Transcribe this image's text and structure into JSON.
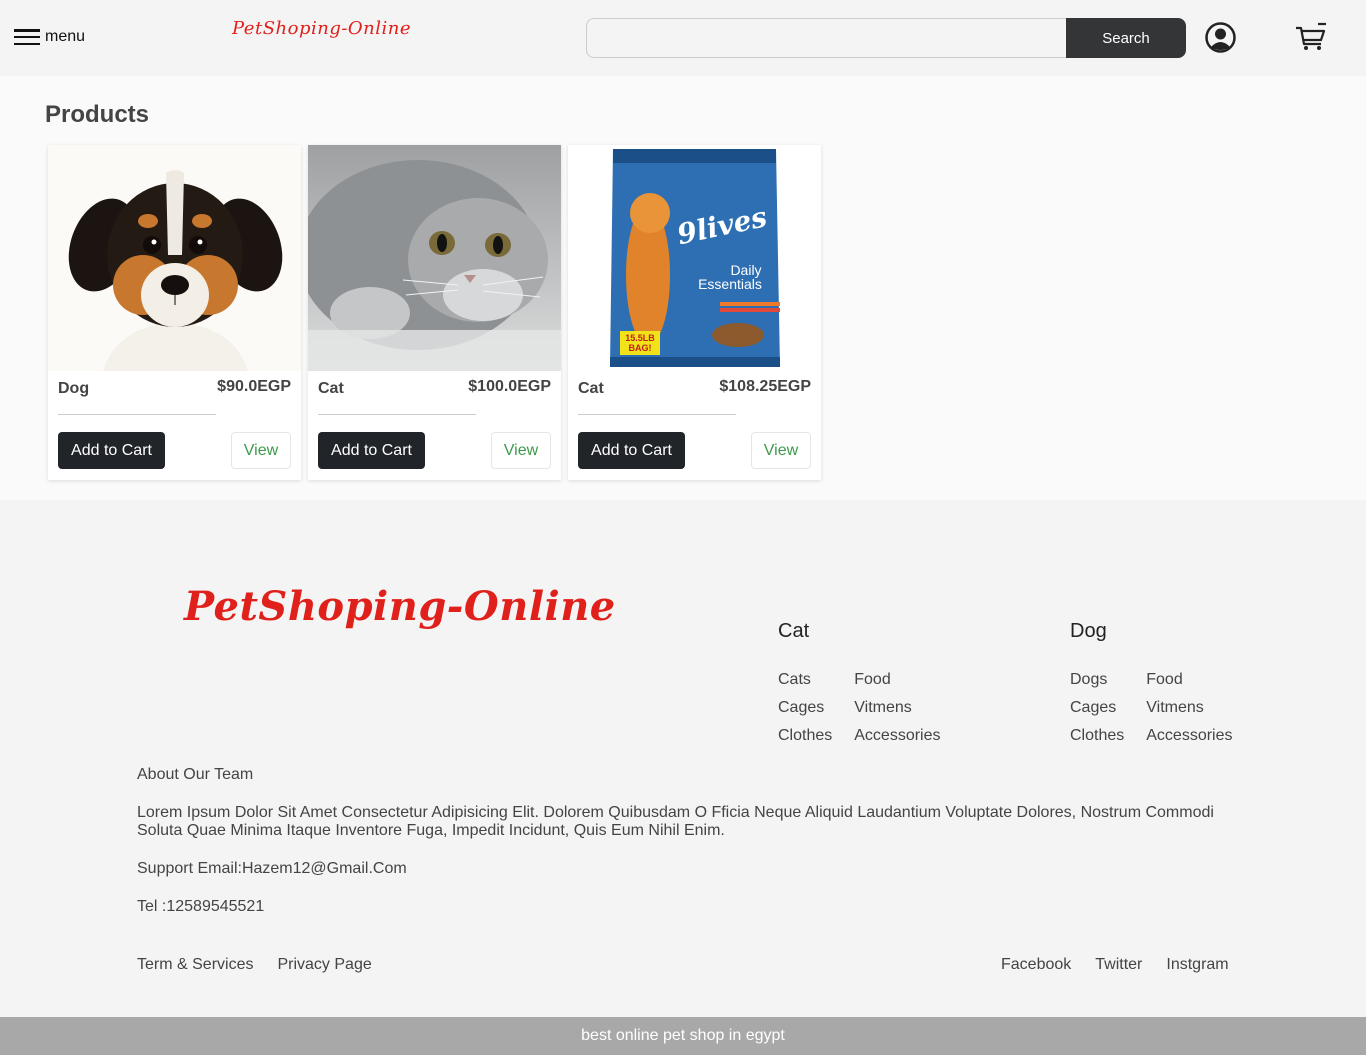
{
  "header": {
    "menu_label": "menu",
    "logo_text": "PetShoping-Online",
    "search_placeholder": "",
    "search_button": "Search"
  },
  "products": {
    "title": "Products",
    "items": [
      {
        "name": "Dog",
        "price": "$90.0EGP",
        "add_label": "Add to Cart",
        "view_label": "View"
      },
      {
        "name": "Cat",
        "price": "$100.0EGP",
        "add_label": "Add to Cart",
        "view_label": "View"
      },
      {
        "name": "Cat",
        "price": "$108.25EGP",
        "add_label": "Add to Cart",
        "view_label": "View"
      }
    ],
    "food_bag": {
      "brand": "9lives",
      "line1": "Daily",
      "line2": "Essentials",
      "badge1": "15.5LB",
      "badge2": "BAG!"
    }
  },
  "footer": {
    "logo_text": "PetShoping-Online",
    "cat": {
      "title": "Cat",
      "links": [
        "Cats",
        "Food",
        "Cages",
        "Vitmens",
        "Clothes",
        "Accessories"
      ]
    },
    "dog": {
      "title": "Dog",
      "links": [
        "Dogs",
        "Food",
        "Cages",
        "Vitmens",
        "Clothes",
        "Accessories"
      ]
    },
    "about_title": "About Our Team",
    "about_text": "Lorem Ipsum Dolor Sit Amet Consectetur Adipisicing Elit. Dolorem Quibusdam O Fficia Neque Aliquid Laudantium Voluptate Dolores, Nostrum Commodi Soluta Quae Minima Itaque Inventore Fuga, Impedit Incidunt, Quis Eum Nihil Enim.",
    "support_email": "Support Email:Hazem12@Gmail.Com",
    "tel": "Tel :12589545521",
    "legal": [
      "Term & Services",
      "Privacy Page"
    ],
    "social": [
      "Facebook",
      "Twitter",
      "Instgram"
    ]
  },
  "bottom_bar": "best online pet shop in egypt",
  "colors": {
    "brand_red": "#e0201b",
    "dark_button": "#212529",
    "view_green": "#3c9a4a",
    "bar_gray": "#a8a8a8"
  }
}
